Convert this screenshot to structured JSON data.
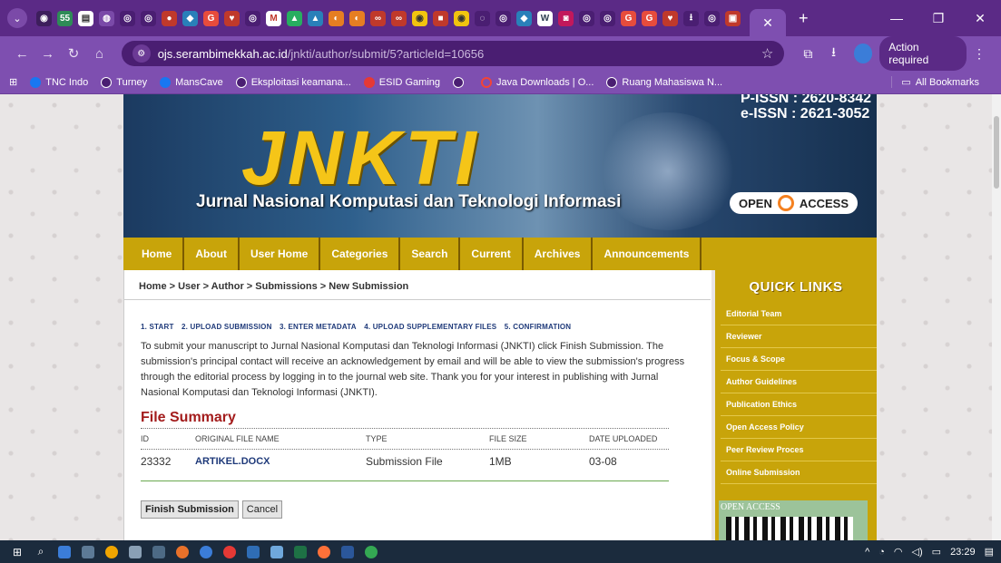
{
  "browser": {
    "url_host": "ojs.serambimekkah.ac.id",
    "url_path": "/jnkti/author/submit/5?articleId=10656",
    "action_required": "Action required",
    "bookmarks": [
      "TNC Indo",
      "Turney",
      "MansCave",
      "Eksploitasi keamana...",
      "ESID Gaming",
      "",
      "Java Downloads | O...",
      "Ruang Mahasiswa N..."
    ],
    "all_bookmarks": "All Bookmarks"
  },
  "banner": {
    "logo": "JNKTI",
    "journal_name": "Jurnal Nasional Komputasi dan Teknologi Informasi",
    "pissn": "P-ISSN : 2620-8342",
    "eissn": "e-ISSN : 2621-3052",
    "open_label": "OPEN",
    "access_label": "ACCESS"
  },
  "nav": [
    "Home",
    "About",
    "User Home",
    "Categories",
    "Search",
    "Current",
    "Archives",
    "Announcements"
  ],
  "breadcrumb": "Home > User > Author > Submissions > New Submission",
  "steps": [
    "1. START",
    "2. UPLOAD SUBMISSION",
    "3. ENTER METADATA",
    "4. UPLOAD SUPPLEMENTARY FILES",
    "5. CONFIRMATION"
  ],
  "instructions": "To submit your manuscript to Jurnal Nasional Komputasi dan Teknologi Informasi (JNKTI) click Finish Submission. The submission's principal contact will receive an acknowledgement by email and will be able to view the submission's progress through the editorial process by logging in to the journal web site. Thank you for your interest in publishing with Jurnal Nasional Komputasi dan Teknologi Informasi (JNKTI).",
  "file_summary": {
    "title": "File Summary",
    "headers": [
      "ID",
      "ORIGINAL FILE NAME",
      "TYPE",
      "FILE SIZE",
      "DATE UPLOADED"
    ],
    "rows": [
      {
        "id": "23332",
        "name": "ARTIKEL.DOCX",
        "type": "Submission File",
        "size": "1MB",
        "date": "03-08"
      }
    ]
  },
  "buttons": {
    "finish": "Finish Submission",
    "cancel": "Cancel"
  },
  "sidebar": {
    "title": "QUICK LINKS",
    "links": [
      "Editorial Team",
      "Reviewer",
      "Focus & Scope",
      "Author Guidelines",
      "Publication Ethics",
      "Open Access Policy",
      "Peer Review Proces",
      "Online Submission"
    ],
    "open_access": "OPEN ACCESS"
  },
  "taskbar": {
    "time": "23:29"
  }
}
